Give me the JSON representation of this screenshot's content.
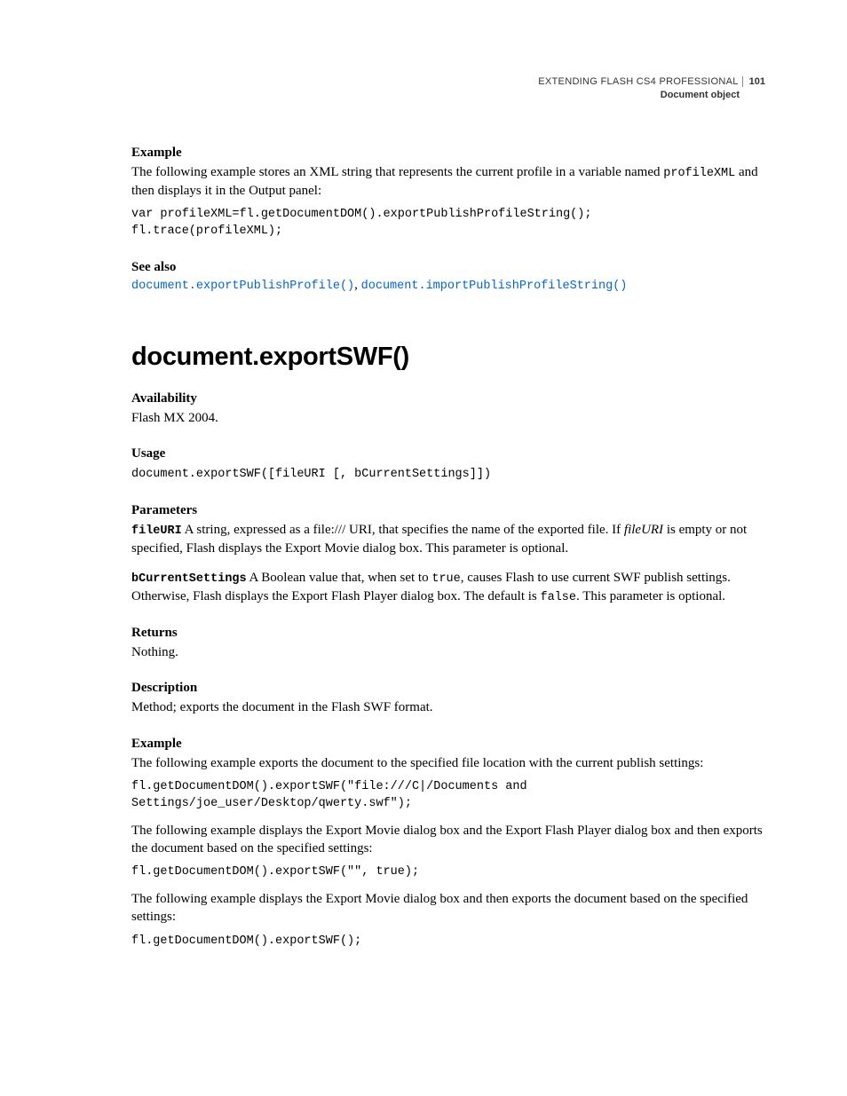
{
  "header": {
    "title": "EXTENDING FLASH CS4 PROFESSIONAL",
    "page_number": "101",
    "subtitle": "Document object"
  },
  "sec1": {
    "heading": "Example",
    "text_before_code": "The following example stores an XML string that represents the current profile in a variable named ",
    "inline_code": "profileXML",
    "text_after_code": " and then displays it in the Output panel:",
    "code": "var profileXML=fl.getDocumentDOM().exportPublishProfileString(); \nfl.trace(profileXML);"
  },
  "seealso": {
    "heading": "See also",
    "link1": "document.exportPublishProfile()",
    "link2": "document.importPublishProfileString()"
  },
  "main": {
    "heading": "document.exportSWF()"
  },
  "availability": {
    "heading": "Availability",
    "text": "Flash MX 2004."
  },
  "usage": {
    "heading": "Usage",
    "code": "document.exportSWF([fileURI [, bCurrentSettings]])"
  },
  "parameters": {
    "heading": "Parameters",
    "p1_name": "fileURI",
    "p1_text_a": "  A string, expressed as a file:/// URI, that specifies the name of the exported file. If ",
    "p1_italic": "fileURI",
    "p1_text_b": " is empty or not specified, Flash displays the Export Movie dialog box. This parameter is optional.",
    "p2_name": "bCurrentSettings",
    "p2_text_a": "  A Boolean value that, when set to ",
    "p2_code_a": "true",
    "p2_text_b": ", causes Flash to use current SWF publish settings. Otherwise, Flash displays the Export Flash Player dialog box. The default is ",
    "p2_code_b": "false",
    "p2_text_c": ". This parameter is optional."
  },
  "returns": {
    "heading": "Returns",
    "text": "Nothing."
  },
  "description": {
    "heading": "Description",
    "text": "Method; exports the document in the Flash SWF format."
  },
  "example2": {
    "heading": "Example",
    "text1": "The following example exports the document to the specified file location with the current publish settings:",
    "code1": "fl.getDocumentDOM().exportSWF(\"file:///C|/Documents and \nSettings/joe_user/Desktop/qwerty.swf\");",
    "text2": "The following example displays the Export Movie dialog box and the Export Flash Player dialog box and then exports the document based on the specified settings:",
    "code2": "fl.getDocumentDOM().exportSWF(\"\", true);",
    "text3": "The following example displays the Export Movie dialog box and then exports the document based on the specified settings:",
    "code3": "fl.getDocumentDOM().exportSWF();"
  }
}
